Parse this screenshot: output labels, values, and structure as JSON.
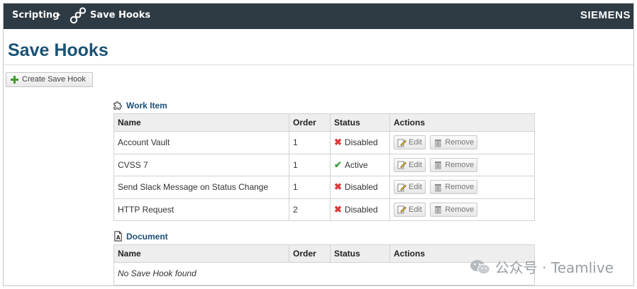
{
  "header": {
    "breadcrumb_root": "Scripting",
    "breadcrumb_current": "Save Hooks",
    "brand": "SIEMENS"
  },
  "page": {
    "title": "Save Hooks",
    "create_button": "Create Save Hook"
  },
  "columns": {
    "name": "Name",
    "order": "Order",
    "status": "Status",
    "actions": "Actions"
  },
  "work_item": {
    "section_label": "Work Item",
    "rows": [
      {
        "name": "Account Vault",
        "order": "1",
        "status": "Disabled",
        "status_type": "disabled"
      },
      {
        "name": "CVSS 7",
        "order": "1",
        "status": "Active",
        "status_type": "active"
      },
      {
        "name": "Send Slack Message on Status Change",
        "order": "1",
        "status": "Disabled",
        "status_type": "disabled"
      },
      {
        "name": "HTTP Request",
        "order": "2",
        "status": "Disabled",
        "status_type": "disabled"
      }
    ]
  },
  "actions": {
    "edit": "Edit",
    "remove": "Remove"
  },
  "document": {
    "section_label": "Document",
    "empty_text": "No Save Hook found"
  },
  "watermark": {
    "text": "公众号 · Teamlive"
  },
  "colors": {
    "topbar": "#2e3a44",
    "title": "#1a5276",
    "disabled": "#d83a3a",
    "active": "#3d9a3d"
  }
}
